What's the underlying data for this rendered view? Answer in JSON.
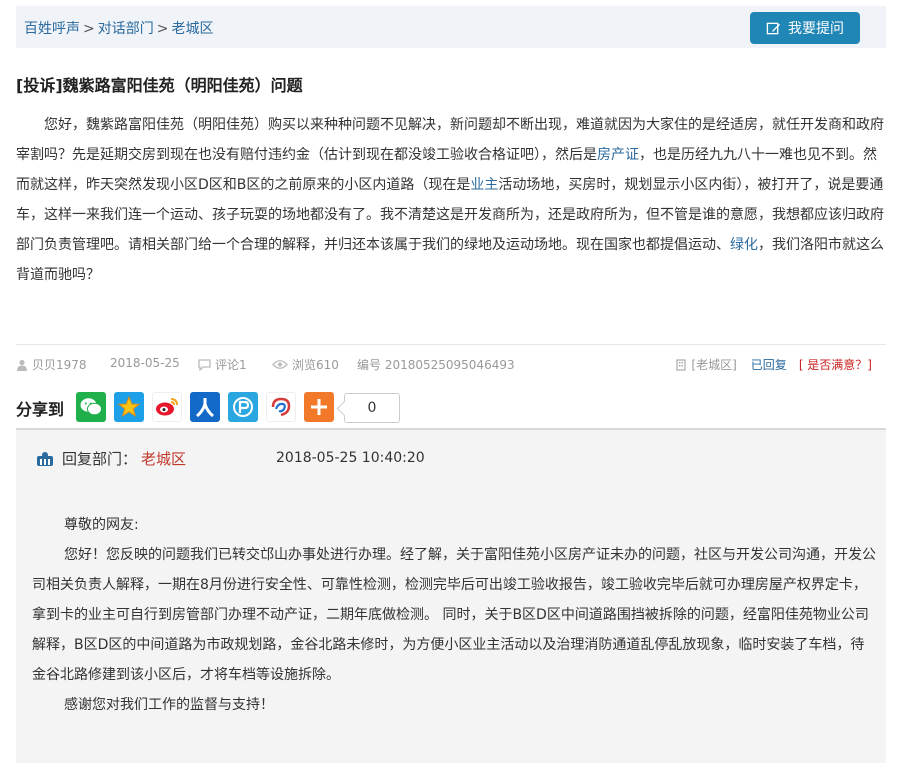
{
  "breadcrumb": {
    "items": [
      "百姓呼声",
      "对话部门",
      "老城区"
    ],
    "separator": ">"
  },
  "ask_button": {
    "label": "我要提问",
    "icon": "edit-icon"
  },
  "title": "[投诉]魏紫路富阳佳苑（明阳佳苑）问题",
  "content": {
    "parts": [
      "您好，魏紫路富阳佳苑（明阳佳苑）购买以来种种问题不见解决，新问题却不断出现，难道就因为大家住的是经适房，就任开发商和政府宰割吗？先是延期交房到现在也没有赔付违约金（估计到现在都没竣工验收合格证吧），然后是",
      "房产证",
      "，也是历经九九八十一难也见不到。然而就这样，昨天突然发现小区D区和B区的之前原来的小区内道路（现在是",
      "业主",
      "活动场地，买房时，规划显示小区内街），被打开了，说是要通车，这样一来我们连一个运动、孩子玩耍的场地都没有了。我不清楚这是开发商所为，还是政府所为，但不管是谁的意愿，我想都应该归政府部门负责管理吧。请相关部门给一个合理的解释，并归还本该属于我们的绿地及运动场地。现在国家也都提倡运动、",
      "绿化",
      "，我们洛阳市就这么背道而驰吗？"
    ]
  },
  "meta": {
    "author": "贝贝1978",
    "date": "2018-05-25",
    "comments": "评论1",
    "views": "浏览610",
    "number": "编号 20180525095046493",
    "dept_tag": "[老城区]",
    "reply_state": "已回复",
    "satisfied": "[ 是否满意？]"
  },
  "share": {
    "label": "分享到",
    "count": "0",
    "icons": [
      "wechat-icon",
      "qzone-icon",
      "weibo-icon",
      "renren-icon",
      "pengyou-icon",
      "sina-icon",
      "more-icon"
    ],
    "colors": {
      "wechat": "#20b04b",
      "qzone": "#f5a623",
      "weibo": "#e6162d",
      "renren": "#1369c8",
      "pengyou": "#2aa6e0",
      "sina": "#d63a3a",
      "more": "#f3792a"
    }
  },
  "reply": {
    "label": "回复部门：",
    "dept": "老城区",
    "time": "2018-05-25 10:40:20",
    "greeting": "尊敬的网友:",
    "body": "您好！您反映的问题我们已转交邙山办事处进行办理。经了解，关于富阳佳苑小区房产证未办的问题，社区与开发公司沟通，开发公司相关负责人解释，一期在8月份进行安全性、可靠性检测，检测完毕后可出竣工验收报告，竣工验收完毕后就可办理房屋产权界定卡，拿到卡的业主可自行到房管部门办理不动产证，二期年底做检测。 同时，关于B区D区中间道路围挡被拆除的问题，经富阳佳苑物业公司解释，B区D区的中间道路为市政规划路，金谷北路未修时，为方便小区业主活动以及治理消防通道乱停乱放现象，临时安装了车档，待金谷北路修建到该小区后，才将车档等设施拆除。",
    "thanks": "感谢您对我们工作的监督与支持！"
  },
  "colors": {
    "link": "#2a6a9e",
    "button": "#1f86b5",
    "dept_red": "#c0392b"
  }
}
